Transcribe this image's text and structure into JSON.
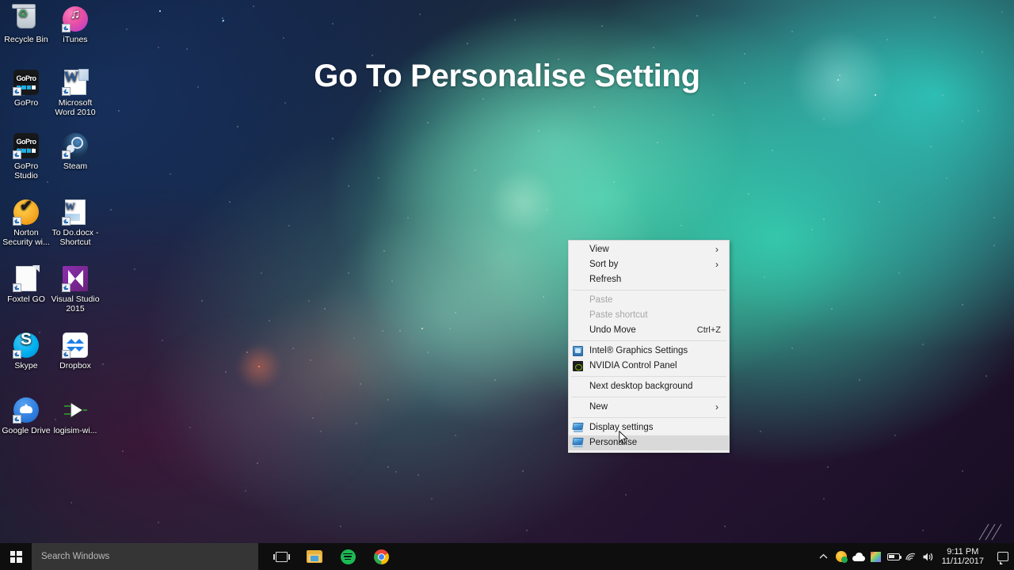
{
  "headline": "Go To Personalise Setting",
  "desktop": {
    "icons": [
      {
        "label": "Recycle Bin",
        "icon": "recycle-bin-icon",
        "shortcut": false
      },
      {
        "label": "iTunes",
        "icon": "itunes-icon",
        "shortcut": true
      },
      {
        "label": "GoPro",
        "icon": "gopro-icon",
        "shortcut": true
      },
      {
        "label": "Microsoft Word 2010",
        "icon": "microsoft-word-icon",
        "shortcut": true
      },
      {
        "label": "GoPro Studio",
        "icon": "gopro-studio-icon",
        "shortcut": true
      },
      {
        "label": "Steam",
        "icon": "steam-icon",
        "shortcut": true
      },
      {
        "label": "Norton Security wi...",
        "icon": "norton-security-icon",
        "shortcut": true
      },
      {
        "label": "To Do.docx - Shortcut",
        "icon": "word-document-icon",
        "shortcut": true
      },
      {
        "label": "Foxtel GO",
        "icon": "blank-file-icon",
        "shortcut": true
      },
      {
        "label": "Visual Studio 2015",
        "icon": "visual-studio-icon",
        "shortcut": true
      },
      {
        "label": "Skype",
        "icon": "skype-icon",
        "shortcut": true
      },
      {
        "label": "Dropbox",
        "icon": "dropbox-icon",
        "shortcut": true
      },
      {
        "label": "Google Drive",
        "icon": "google-drive-icon",
        "shortcut": true
      },
      {
        "label": "logisim-wi...",
        "icon": "logisim-icon",
        "shortcut": false
      }
    ]
  },
  "context_menu": {
    "items": [
      {
        "label": "View",
        "icon": null,
        "accel": "",
        "arrow": "›",
        "disabled": false,
        "selected": false
      },
      {
        "label": "Sort by",
        "icon": null,
        "accel": "",
        "arrow": "›",
        "disabled": false,
        "selected": false
      },
      {
        "label": "Refresh",
        "icon": null,
        "accel": "",
        "arrow": "",
        "disabled": false,
        "selected": false
      },
      {
        "separator": true
      },
      {
        "label": "Paste",
        "icon": null,
        "accel": "",
        "arrow": "",
        "disabled": true,
        "selected": false
      },
      {
        "label": "Paste shortcut",
        "icon": null,
        "accel": "",
        "arrow": "",
        "disabled": true,
        "selected": false
      },
      {
        "label": "Undo Move",
        "icon": null,
        "accel": "Ctrl+Z",
        "arrow": "",
        "disabled": false,
        "selected": false
      },
      {
        "separator": true
      },
      {
        "label": "Intel® Graphics Settings",
        "icon": "intel-graphics-icon",
        "accel": "",
        "arrow": "",
        "disabled": false,
        "selected": false
      },
      {
        "label": "NVIDIA Control Panel",
        "icon": "nvidia-icon",
        "accel": "",
        "arrow": "",
        "disabled": false,
        "selected": false
      },
      {
        "separator": true
      },
      {
        "label": "Next desktop background",
        "icon": null,
        "accel": "",
        "arrow": "",
        "disabled": false,
        "selected": false
      },
      {
        "separator": true
      },
      {
        "label": "New",
        "icon": null,
        "accel": "",
        "arrow": "›",
        "disabled": false,
        "selected": false
      },
      {
        "separator": true
      },
      {
        "label": "Display settings",
        "icon": "display-icon",
        "accel": "",
        "arrow": "",
        "disabled": false,
        "selected": false
      },
      {
        "label": "Personalise",
        "icon": "personalise-icon",
        "accel": "",
        "arrow": "",
        "disabled": false,
        "selected": true
      }
    ]
  },
  "taskbar": {
    "start_label": "Start",
    "search_placeholder": "Search Windows",
    "search_value": "",
    "apps": [
      {
        "name": "task-view-button",
        "label": "Task View"
      },
      {
        "name": "file-explorer-button",
        "label": "File Explorer"
      },
      {
        "name": "spotify-button",
        "label": "Spotify"
      },
      {
        "name": "chrome-button",
        "label": "Google Chrome"
      }
    ],
    "tray": [
      {
        "name": "show-hidden-icons-button",
        "label": "Show hidden icons"
      },
      {
        "name": "norton-tray-icon",
        "label": "Norton Security"
      },
      {
        "name": "onedrive-tray-icon",
        "label": "OneDrive"
      },
      {
        "name": "color-swatch-tray-icon",
        "label": "Display colour profile"
      },
      {
        "name": "battery-tray-icon",
        "label": "Battery"
      },
      {
        "name": "network-tray-icon",
        "label": "Wi-Fi"
      },
      {
        "name": "volume-tray-icon",
        "label": "Volume"
      }
    ],
    "clock": {
      "time": "9:11 PM",
      "date": "11/11/2017"
    },
    "action_center_label": "Action Center"
  },
  "colors": {
    "accent_teal": "#2fc3b8",
    "menu_bg": "#f2f2f2",
    "menu_selected": "#d9d9d9",
    "taskbar_bg": "#0e0e0e",
    "search_bg": "#353535",
    "disabled_text": "#a6a6a6"
  }
}
